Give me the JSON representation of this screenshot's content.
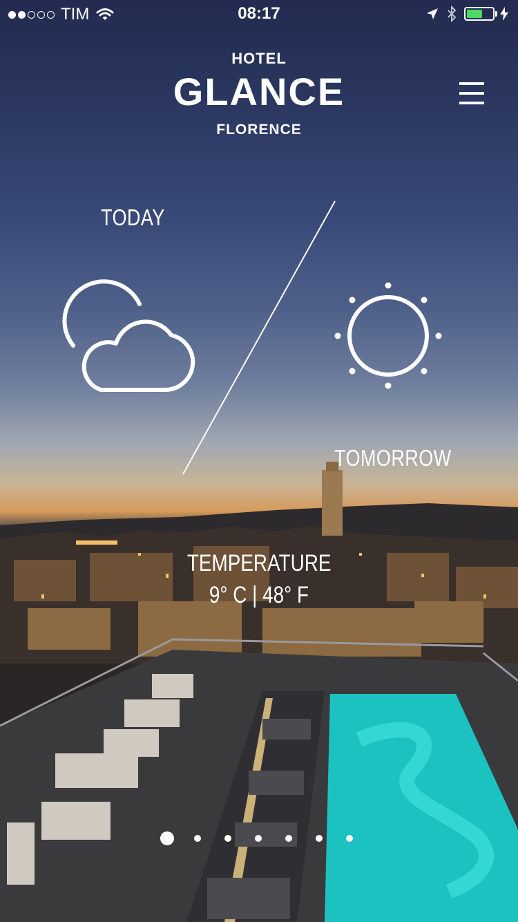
{
  "status_bar": {
    "signal_dots_filled": 2,
    "signal_dots_total": 5,
    "carrier": "TIM",
    "time": "08:17",
    "battery_level": 0.6,
    "battery_color": "#4cd964",
    "icons": [
      "wifi-icon",
      "location-arrow-icon",
      "bluetooth-icon",
      "battery-icon",
      "charging-bolt-icon"
    ]
  },
  "header": {
    "line1": "HOTEL",
    "title": "GLANCE",
    "line3": "FLORENCE",
    "menu_icon": "hamburger-menu-icon"
  },
  "weather": {
    "today": {
      "label": "TODAY",
      "icon": "partly-cloudy-icon"
    },
    "tomorrow": {
      "label": "TOMORROW",
      "icon": "sun-icon"
    },
    "temperature": {
      "label": "TEMPERATURE",
      "value": "9° C | 48° F"
    }
  },
  "pager": {
    "total": 7,
    "active_index": 0
  },
  "background": {
    "scene": "rooftop-pool-florence-dusk-photo"
  }
}
